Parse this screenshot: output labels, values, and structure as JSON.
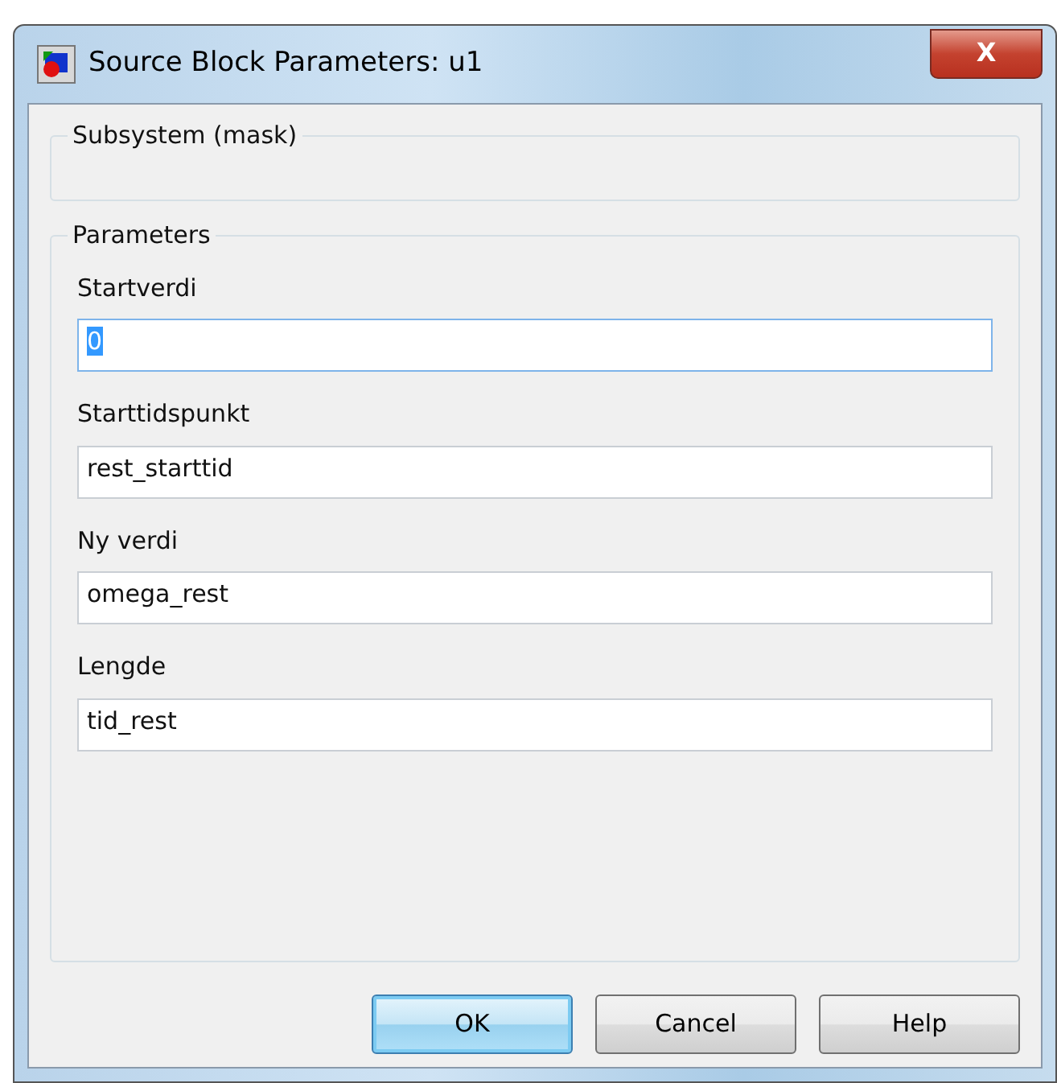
{
  "window": {
    "title": "Source Block Parameters: u1",
    "close_label": "X"
  },
  "groups": [
    {
      "legend": "Subsystem (mask)"
    },
    {
      "legend": "Parameters",
      "fields": [
        {
          "label": "Startverdi",
          "value": "0",
          "focused": true
        },
        {
          "label": "Starttidspunkt",
          "value": "rest_starttid",
          "focused": false
        },
        {
          "label": "Ny verdi",
          "value": "omega_rest",
          "focused": false
        },
        {
          "label": "Lengde",
          "value": "tid_rest",
          "focused": false
        }
      ]
    }
  ],
  "buttons": [
    {
      "label": "OK",
      "default": true
    },
    {
      "label": "Cancel",
      "default": false
    },
    {
      "label": "Help",
      "default": false
    }
  ]
}
